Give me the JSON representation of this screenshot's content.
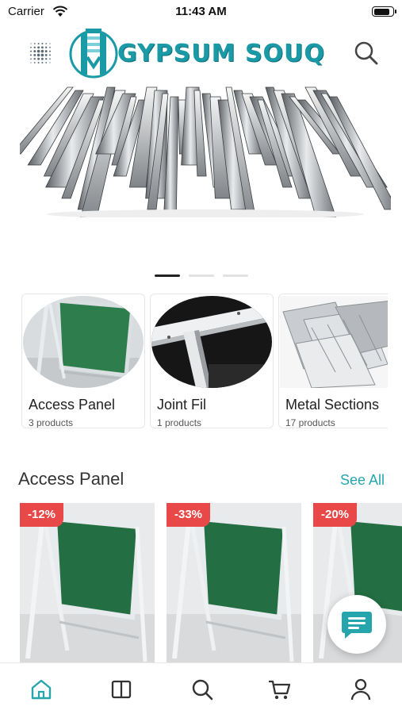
{
  "status_bar": {
    "carrier": "Carrier",
    "time": "11:43 AM",
    "battery_level": 0.9
  },
  "header": {
    "logo_text": "GYPSUM SOUQ",
    "menu_icon": "grid-dots-icon",
    "search_icon": "search-icon"
  },
  "banner": {
    "image": "metal-profiles-bundle",
    "page_count": 3,
    "active_page": 1
  },
  "categories": [
    {
      "name": "Access Panel",
      "count": "3 products",
      "image": "access-panel"
    },
    {
      "name": "Joint Fil",
      "count": "1 products",
      "image": "joint-fil"
    },
    {
      "name": "Metal Sections",
      "count": "17 products",
      "image": "metal-sections"
    }
  ],
  "section": {
    "title": "Access Panel",
    "see_all": "See All"
  },
  "products": [
    {
      "discount": "-12%",
      "image": "access-panel"
    },
    {
      "discount": "-33%",
      "image": "access-panel"
    },
    {
      "discount": "-20%",
      "image": "access-panel"
    }
  ],
  "chat_icon": "chat-bubble-icon",
  "bottom_nav": [
    {
      "icon": "home-icon",
      "active": true
    },
    {
      "icon": "catalog-icon",
      "active": false
    },
    {
      "icon": "search-icon",
      "active": false
    },
    {
      "icon": "cart-icon",
      "active": false
    },
    {
      "icon": "profile-icon",
      "active": false
    }
  ],
  "colors": {
    "brand": "#1a9aa6",
    "accent": "#26a5ad",
    "discount": "#e94848",
    "active_nav": "#26a5ad",
    "inactive_nav": "#333333"
  }
}
